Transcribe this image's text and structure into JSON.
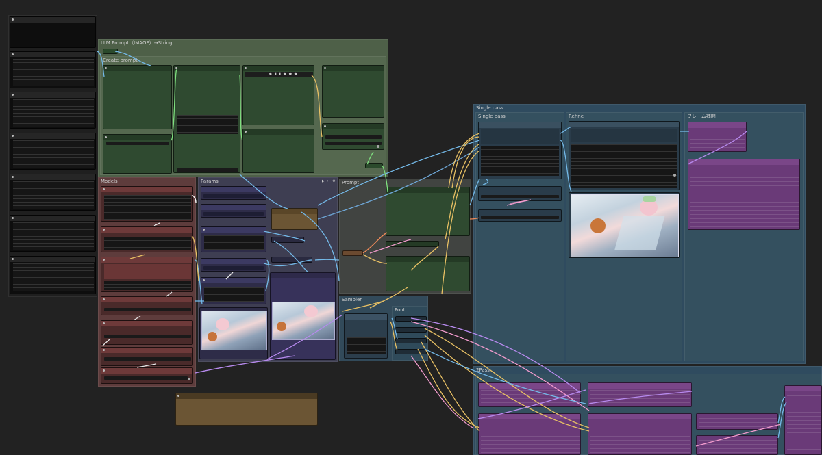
{
  "groups": {
    "llm_prompt": "LLM Prompt（IMAGE）→String",
    "create_prompt": "Create prompt",
    "models": "Models",
    "params": "Params",
    "prompt": "Prompt",
    "sampler": "Sampler",
    "output": "Pout",
    "single_pass": "Single pass",
    "single_pass_inner": "Single pass",
    "refine": "Refine",
    "frame_interp": "フレーム補間",
    "second_pass": "2Pass"
  },
  "controls": {
    "params_header": "▶ ↔ ⚙",
    "image_toolbar": "◐ ▮ ▮ ● ● ●"
  },
  "colors": {
    "canvas": "#222222",
    "green_node": "#2f4a30",
    "red_node": "#4a2a2a",
    "purple_node": "#3a3458",
    "teal_group": "#2f4b5f",
    "magenta_node": "#6a3a78",
    "brown_node": "#6b5534"
  },
  "icons": {
    "collapse": "dot-icon",
    "image_preview": "anime-girl-image"
  }
}
